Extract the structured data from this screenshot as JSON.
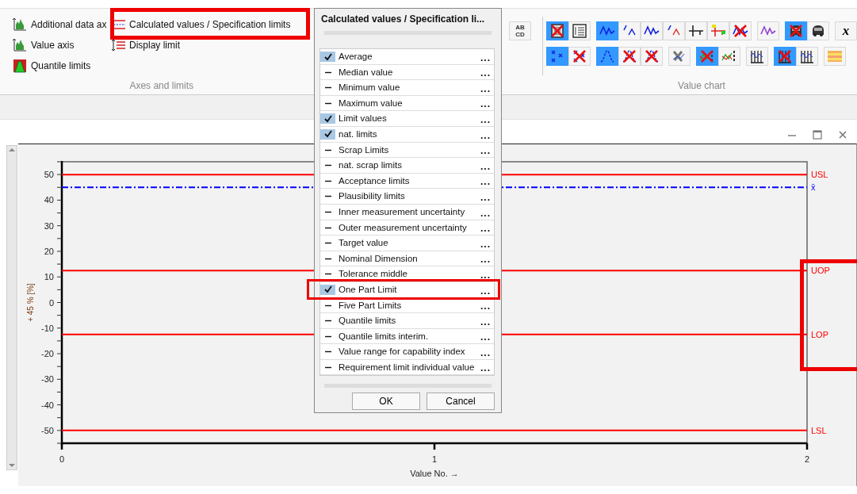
{
  "ribbon": {
    "axes_group": {
      "label": "Axes and limits",
      "columns": [
        [
          {
            "label": "Additional data ax",
            "kind": "histogram"
          },
          {
            "label": "Value axis",
            "kind": "histogram"
          },
          {
            "label": "Quantile limits",
            "kind": "quantile"
          }
        ],
        [
          {
            "label": "Calculated values / Specification limits",
            "kind": "limit-lines"
          },
          {
            "label": "Display limit",
            "kind": "display-limit"
          }
        ]
      ]
    },
    "legend_button": {
      "lines": [
        "AB",
        "CD"
      ]
    },
    "value_chart": {
      "label": "Value chart",
      "rows": [
        {
          "groups": [
            [
              {
                "kind": "frame",
                "on": true,
                "crossed": true
              },
              {
                "kind": "list",
                "on": false,
                "crossed": false
              }
            ],
            [
              {
                "kind": "wave",
                "on": true,
                "crossed": false
              },
              {
                "kind": "segments",
                "on": false,
                "crossed": false
              },
              {
                "kind": "wave",
                "on": false,
                "crossed": false
              },
              {
                "kind": "segments-red",
                "on": false,
                "crossed": false
              },
              {
                "kind": "ticks",
                "on": false,
                "crossed": false
              },
              {
                "kind": "ticks-color",
                "on": false,
                "crossed": false
              },
              {
                "kind": "wave",
                "on": false,
                "crossed": true
              }
            ],
            [
              {
                "kind": "wave-purple",
                "on": false,
                "crossed": false
              }
            ],
            [
              {
                "kind": "car",
                "on": true,
                "crossed": true
              },
              {
                "kind": "car",
                "on": false,
                "crossed": false
              }
            ],
            [
              {
                "kind": "letter",
                "label": "x",
                "on": false
              }
            ]
          ]
        },
        {
          "groups": [
            [
              {
                "kind": "points",
                "on": true,
                "crossed": false
              },
              {
                "kind": "points",
                "on": false,
                "crossed": true
              }
            ],
            [
              {
                "kind": "peak",
                "on": true,
                "crossed": false
              },
              {
                "kind": "peak",
                "on": false,
                "crossed": true
              },
              {
                "kind": "peak",
                "on": false,
                "crossed": true
              }
            ],
            [
              {
                "kind": "tools",
                "on": false,
                "crossed": false
              }
            ],
            [
              {
                "kind": "ranks",
                "on": true,
                "crossed": true
              },
              {
                "kind": "ranks",
                "on": false,
                "crossed": false
              }
            ],
            [
              {
                "kind": "bars",
                "on": false,
                "crossed": false
              }
            ],
            [
              {
                "kind": "bars",
                "on": true,
                "crossed": true
              },
              {
                "kind": "bars",
                "on": false,
                "crossed": false
              }
            ],
            [
              {
                "kind": "stripes",
                "on": false,
                "crossed": false
              }
            ]
          ]
        }
      ]
    }
  },
  "dialog": {
    "title": "Calculated values / Specification li...",
    "items": [
      {
        "label": "Average",
        "checked": true,
        "more": "..."
      },
      {
        "label": "Median value",
        "checked": false,
        "more": "..."
      },
      {
        "label": "Minimum value",
        "checked": false,
        "more": "..."
      },
      {
        "label": "Maximum value",
        "checked": false,
        "more": "..."
      },
      {
        "label": "Limit values",
        "checked": true,
        "more": "..."
      },
      {
        "label": "nat. limits",
        "checked": true,
        "more": "..."
      },
      {
        "label": "Scrap Limits",
        "checked": false,
        "more": "..."
      },
      {
        "label": "nat. scrap limits",
        "checked": false,
        "more": "..."
      },
      {
        "label": "Acceptance limits",
        "checked": false,
        "more": "..."
      },
      {
        "label": "Plausibility limits",
        "checked": false,
        "more": "..."
      },
      {
        "label": "Inner measurement uncertainty",
        "checked": false,
        "more": "..."
      },
      {
        "label": "Outer measurement uncertainty",
        "checked": false,
        "more": "..."
      },
      {
        "label": "Target value",
        "checked": false,
        "more": "..."
      },
      {
        "label": "Nominal Dimension",
        "checked": false,
        "more": "..."
      },
      {
        "label": "Tolerance middle",
        "checked": false,
        "more": "..."
      },
      {
        "label": "One Part Limit",
        "checked": true,
        "more": "..."
      },
      {
        "label": "Five Part Limits",
        "checked": false,
        "more": "..."
      },
      {
        "label": "Quantile limits",
        "checked": false,
        "more": "..."
      },
      {
        "label": "Quantile limits interim.",
        "checked": false,
        "more": "..."
      },
      {
        "label": "Value range for capability index",
        "checked": false,
        "more": "..."
      },
      {
        "label": "Requirement limit individual value",
        "checked": false,
        "more": "..."
      }
    ],
    "buttons": [
      "OK",
      "Cancel"
    ]
  },
  "chart": {
    "chart_data": {
      "type": "line",
      "xlabel": "Value No. →",
      "ylabel": "+ 45 % [%]",
      "x": [
        0,
        2
      ],
      "xlim": [
        0,
        2
      ],
      "ylim": [
        -55,
        55
      ],
      "xticks": [
        0,
        1,
        2
      ],
      "yticks": [
        -50,
        -40,
        -30,
        -20,
        -10,
        0,
        10,
        20,
        30,
        40,
        50
      ],
      "series": [
        {
          "name": "USL",
          "color": "#ff0000",
          "values": [
            50,
            50
          ]
        },
        {
          "name": "x̄",
          "color": "#0000ff",
          "line_style": "dashdot",
          "values": [
            45,
            45
          ]
        },
        {
          "name": "UOP",
          "color": "#ff0000",
          "values": [
            12.5,
            12.5
          ]
        },
        {
          "name": "LOP",
          "color": "#ff0000",
          "values": [
            -12.5,
            -12.5
          ]
        },
        {
          "name": "LSL",
          "color": "#ff0000",
          "values": [
            -50,
            -50
          ]
        }
      ]
    }
  }
}
